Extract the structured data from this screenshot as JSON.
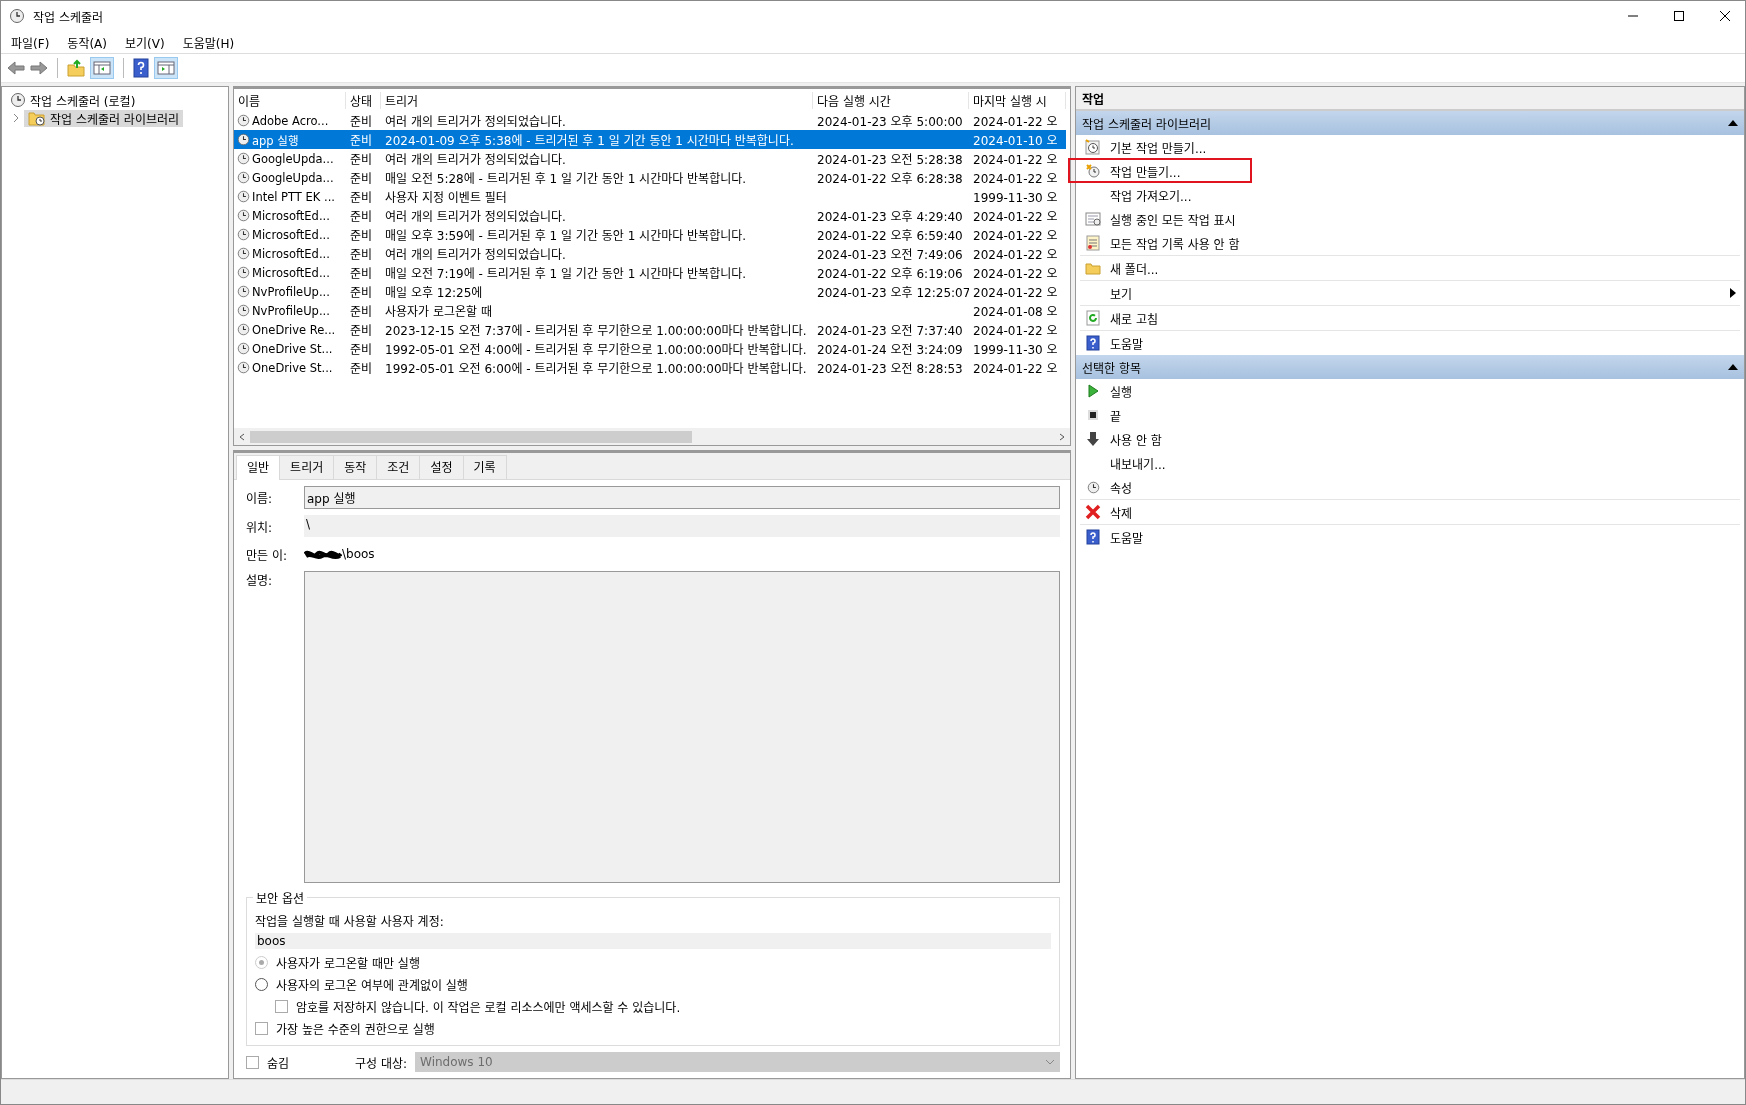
{
  "window": {
    "title": "작업 스케줄러"
  },
  "menu": [
    "파일(F)",
    "동작(A)",
    "보기(V)",
    "도움말(H)"
  ],
  "tree": [
    {
      "label": "작업 스케줄러 (로컬)",
      "selected": false,
      "children": [
        {
          "label": "작업 스케줄러 라이브러리",
          "selected": true,
          "expanded": false
        }
      ]
    }
  ],
  "table": {
    "columns": [
      "이름",
      "상태",
      "트리거",
      "다음 실행 시간",
      "마지막 실행 시"
    ],
    "rows": [
      {
        "name": "Adobe Acro...",
        "status": "준비",
        "trigger": "여러 개의 트리거가 정의되었습니다.",
        "next_run": "2024-01-23 오후 5:00:00",
        "last_run": "2024-01-22 오",
        "selected": false
      },
      {
        "name": "app 실행",
        "status": "준비",
        "trigger": "2024-01-09 오후 5:38에 - 트리거된 후 1 일 기간 동안 1 시간마다 반복합니다.",
        "next_run": "",
        "last_run": "2024-01-10 오",
        "selected": true
      },
      {
        "name": "GoogleUpda...",
        "status": "준비",
        "trigger": "여러 개의 트리거가 정의되었습니다.",
        "next_run": "2024-01-23 오전 5:28:38",
        "last_run": "2024-01-22 오",
        "selected": false
      },
      {
        "name": "GoogleUpda...",
        "status": "준비",
        "trigger": "매일 오전 5:28에 - 트리거된 후 1 일 기간 동안 1 시간마다 반복합니다.",
        "next_run": "2024-01-22 오후 6:28:38",
        "last_run": "2024-01-22 오",
        "selected": false
      },
      {
        "name": "Intel PTT EK ...",
        "status": "준비",
        "trigger": "사용자 지정 이벤트 필터",
        "next_run": "",
        "last_run": "1999-11-30 오",
        "selected": false
      },
      {
        "name": "MicrosoftEd...",
        "status": "준비",
        "trigger": "여러 개의 트리거가 정의되었습니다.",
        "next_run": "2024-01-23 오후 4:29:40",
        "last_run": "2024-01-22 오",
        "selected": false
      },
      {
        "name": "MicrosoftEd...",
        "status": "준비",
        "trigger": "매일 오후 3:59에 - 트리거된 후 1 일 기간 동안 1 시간마다 반복합니다.",
        "next_run": "2024-01-22 오후 6:59:40",
        "last_run": "2024-01-22 오",
        "selected": false
      },
      {
        "name": "MicrosoftEd...",
        "status": "준비",
        "trigger": "여러 개의 트리거가 정의되었습니다.",
        "next_run": "2024-01-23 오전 7:49:06",
        "last_run": "2024-01-22 오",
        "selected": false
      },
      {
        "name": "MicrosoftEd...",
        "status": "준비",
        "trigger": "매일 오전 7:19에 - 트리거된 후 1 일 기간 동안 1 시간마다 반복합니다.",
        "next_run": "2024-01-22 오후 6:19:06",
        "last_run": "2024-01-22 오",
        "selected": false
      },
      {
        "name": "NvProfileUp...",
        "status": "준비",
        "trigger": "매일 오후 12:25에",
        "next_run": "2024-01-23 오후 12:25:07",
        "last_run": "2024-01-22 오",
        "selected": false
      },
      {
        "name": "NvProfileUp...",
        "status": "준비",
        "trigger": "사용자가 로그온할 때",
        "next_run": "",
        "last_run": "2024-01-08 오",
        "selected": false
      },
      {
        "name": "OneDrive Re...",
        "status": "준비",
        "trigger": "2023-12-15 오전 7:37에 - 트리거된 후 무기한으로 1.00:00:00마다 반복합니다.",
        "next_run": "2024-01-23 오전 7:37:40",
        "last_run": "2024-01-22 오",
        "selected": false
      },
      {
        "name": "OneDrive St...",
        "status": "준비",
        "trigger": "1992-05-01 오전 4:00에 - 트리거된 후 무기한으로 1.00:00:00마다 반복합니다.",
        "next_run": "2024-01-24 오전 3:24:09",
        "last_run": "1999-11-30 오",
        "selected": false
      },
      {
        "name": "OneDrive St...",
        "status": "준비",
        "trigger": "1992-05-01 오전 6:00에 - 트리거된 후 무기한으로 1.00:00:00마다 반복합니다.",
        "next_run": "2024-01-23 오전 8:28:53",
        "last_run": "2024-01-22 오",
        "selected": false
      }
    ]
  },
  "detail_tabs": [
    {
      "label": "일반",
      "selected": true
    },
    {
      "label": "트리거",
      "selected": false
    },
    {
      "label": "동작",
      "selected": false
    },
    {
      "label": "조건",
      "selected": false
    },
    {
      "label": "설정",
      "selected": false
    },
    {
      "label": "기록",
      "selected": false
    }
  ],
  "general": {
    "name_label": "이름:",
    "name_value": "app 실행",
    "location_label": "위치:",
    "location_value": "\\",
    "author_label": "만든 이:",
    "author_value": "\\boos",
    "author_redacted": true,
    "description_label": "설명:"
  },
  "security": {
    "title": "보안 옵션",
    "account_label": "작업을 실행할 때 사용할 사용자 계정:",
    "account": "boos",
    "options": [
      {
        "kind": "radio",
        "label": "사용자가 로그온할 때만 실행",
        "selected": true,
        "disabled": true
      },
      {
        "kind": "radio",
        "label": "사용자의 로그온 여부에 관계없이 실행",
        "selected": false,
        "disabled": false,
        "children": [
          {
            "kind": "checkbox",
            "label": "암호를 저장하지 않습니다. 이 작업은 로컬 리소스에만 액세스할 수 있습니다.",
            "checked": false
          }
        ]
      },
      {
        "kind": "checkbox",
        "label": "가장 높은 수준의 권한으로 실행",
        "checked": false
      }
    ]
  },
  "hidden": {
    "label": "숨김",
    "checked": false
  },
  "configure_for": {
    "label": "구성 대상:",
    "value": "Windows 10",
    "disabled": true
  },
  "actions": {
    "title": "작업",
    "sections": [
      {
        "title": "작업 스케줄러 라이브러리",
        "expanded": true,
        "items": [
          {
            "label": "기본 작업 만들기...",
            "highlighted": false
          },
          {
            "label": "작업 만들기...",
            "highlighted": true
          },
          {
            "label": "작업 가져오기...",
            "highlighted": false
          },
          {
            "label": "실행 중인 모든 작업 표시",
            "highlighted": false
          },
          {
            "label": "모든 작업 기록 사용 안 함",
            "highlighted": false
          },
          {
            "label": "새 폴더...",
            "highlighted": false
          },
          {
            "label": "보기",
            "highlighted": false,
            "submenu": true
          },
          {
            "label": "새로 고침",
            "highlighted": false
          },
          {
            "label": "도움말",
            "highlighted": false
          }
        ]
      },
      {
        "title": "선택한 항목",
        "expanded": true,
        "items": [
          {
            "label": "실행",
            "highlighted": false
          },
          {
            "label": "끝",
            "highlighted": false
          },
          {
            "label": "사용 안 함",
            "highlighted": false
          },
          {
            "label": "내보내기...",
            "highlighted": false
          },
          {
            "label": "속성",
            "highlighted": false
          },
          {
            "label": "삭제",
            "highlighted": false
          },
          {
            "label": "도움말",
            "highlighted": false
          }
        ]
      }
    ]
  }
}
